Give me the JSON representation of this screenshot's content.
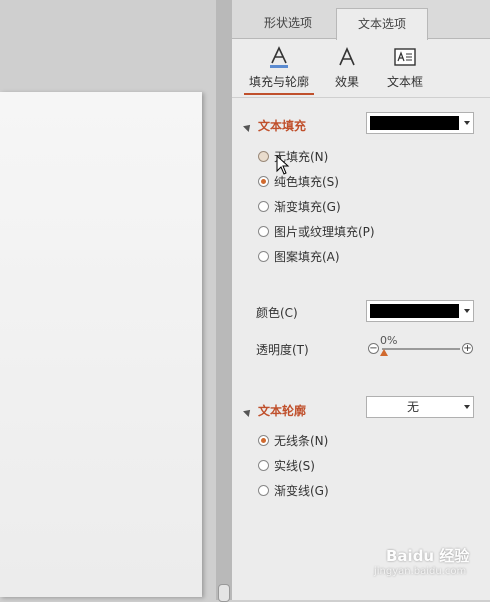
{
  "tabs": {
    "shape_options": "形状选项",
    "text_options": "文本选项"
  },
  "subtabs": {
    "fill_outline": "填充与轮廓",
    "effects": "效果",
    "textbox": "文本框"
  },
  "text_fill": {
    "heading": "文本填充",
    "color_swatch": "#000000",
    "options": [
      {
        "label": "无填充(N)",
        "selected": false
      },
      {
        "label": "纯色填充(S)",
        "selected": true
      },
      {
        "label": "渐变填充(G)",
        "selected": false
      },
      {
        "label": "图片或纹理填充(P)",
        "selected": false
      },
      {
        "label": "图案填充(A)",
        "selected": false
      }
    ],
    "color_label": "颜色(C)",
    "transparency_label": "透明度(T)",
    "transparency_value": "0%"
  },
  "text_outline": {
    "heading": "文本轮廓",
    "dropdown_value": "无",
    "options": [
      {
        "label": "无线条(N)",
        "selected": true
      },
      {
        "label": "实线(S)",
        "selected": false
      },
      {
        "label": "渐变线(G)",
        "selected": false
      }
    ]
  },
  "watermark": {
    "brand": "Baidu 经验",
    "url": "jingyan.baidu.com"
  },
  "colors": {
    "accent": "#c0502c",
    "radio_selected": "#d0692e"
  }
}
